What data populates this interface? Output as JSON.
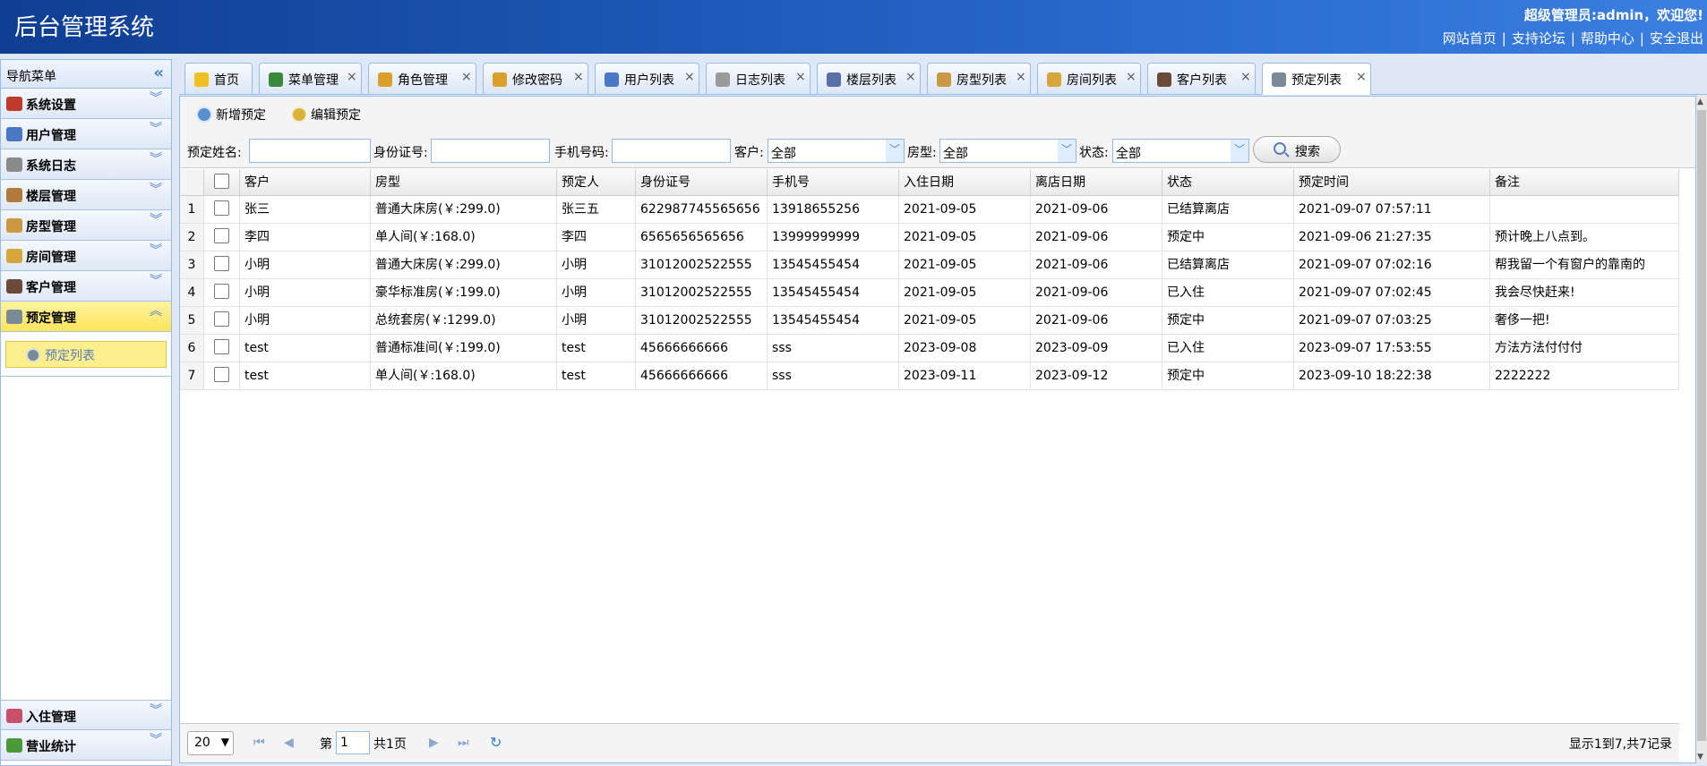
{
  "header": {
    "title": "后台管理系统",
    "welcome": "超级管理员:admin，欢迎您!",
    "links": [
      "网站首页",
      "支持论坛",
      "帮助中心",
      "安全退出"
    ]
  },
  "sidebar": {
    "title": "导航菜单",
    "items": [
      {
        "label": "系统设置",
        "icon": "tools-icon",
        "color": "#c0392b"
      },
      {
        "label": "用户管理",
        "icon": "users-icon",
        "color": "#4a78c8"
      },
      {
        "label": "系统日志",
        "icon": "log-icon",
        "color": "#8a8a8a"
      },
      {
        "label": "楼层管理",
        "icon": "house-icon",
        "color": "#b07a3a"
      },
      {
        "label": "房型管理",
        "icon": "house-icon",
        "color": "#c99a43"
      },
      {
        "label": "房间管理",
        "icon": "house-icon",
        "color": "#d6a63a"
      },
      {
        "label": "客户管理",
        "icon": "person-icon",
        "color": "#6b4a3a"
      },
      {
        "label": "预定管理",
        "icon": "clock-icon",
        "color": "#7a8b96"
      }
    ],
    "sub_item": "预定列表",
    "bottom_items": [
      {
        "label": "入住管理",
        "icon": "checkin-icon",
        "color": "#c9506b"
      },
      {
        "label": "营业统计",
        "icon": "yen-icon",
        "color": "#4a9a3a"
      }
    ]
  },
  "tabs": [
    {
      "label": "首页",
      "icon": "bulb-icon",
      "color": "#f0c020",
      "closable": false
    },
    {
      "label": "菜单管理",
      "icon": "sitemap-icon",
      "color": "#3b8a3b",
      "closable": true
    },
    {
      "label": "角色管理",
      "icon": "users-icon",
      "color": "#d9a02a",
      "closable": true
    },
    {
      "label": "修改密码",
      "icon": "lock-icon",
      "color": "#d9a02a",
      "closable": true
    },
    {
      "label": "用户列表",
      "icon": "users-icon",
      "color": "#4a78c8",
      "closable": true
    },
    {
      "label": "日志列表",
      "icon": "doc-icon",
      "color": "#9a9a9a",
      "closable": true
    },
    {
      "label": "楼层列表",
      "icon": "house-icon",
      "color": "#5a6fa8",
      "closable": true
    },
    {
      "label": "房型列表",
      "icon": "house-icon",
      "color": "#c99a43",
      "closable": true
    },
    {
      "label": "房间列表",
      "icon": "house-icon",
      "color": "#d6a63a",
      "closable": true
    },
    {
      "label": "客户列表",
      "icon": "person-icon",
      "color": "#6b4a3a",
      "closable": true
    },
    {
      "label": "预定列表",
      "icon": "clock-icon",
      "color": "#7a8b96",
      "closable": true,
      "active": true
    }
  ],
  "toolbar": {
    "add_label": "新增预定",
    "edit_label": "编辑预定"
  },
  "search": {
    "name_label": "预定姓名:",
    "id_label": "身份证号:",
    "phone_label": "手机号码:",
    "customer_label": "客户:",
    "customer_value": "全部",
    "roomtype_label": "房型:",
    "roomtype_value": "全部",
    "status_label": "状态:",
    "status_value": "全部",
    "button_label": "搜索"
  },
  "grid": {
    "columns": [
      "客户",
      "房型",
      "预定人",
      "身份证号",
      "手机号",
      "入住日期",
      "离店日期",
      "状态",
      "预定时间",
      "备注"
    ],
    "rows": [
      [
        "1",
        "张三",
        "普通大床房(￥:299.0)",
        "张三五",
        "622987745565656",
        "13918655256",
        "2021-09-05",
        "2021-09-06",
        "已结算离店",
        "2021-09-07 07:57:11",
        ""
      ],
      [
        "2",
        "李四",
        "单人间(￥:168.0)",
        "李四",
        "6565656565656",
        "13999999999",
        "2021-09-05",
        "2021-09-06",
        "预定中",
        "2021-09-06 21:27:35",
        "预计晚上八点到。"
      ],
      [
        "3",
        "小明",
        "普通大床房(￥:299.0)",
        "小明",
        "31012002522555",
        "13545455454",
        "2021-09-05",
        "2021-09-06",
        "已结算离店",
        "2021-09-07 07:02:16",
        "帮我留一个有窗户的靠南的"
      ],
      [
        "4",
        "小明",
        "豪华标准房(￥:199.0)",
        "小明",
        "31012002522555",
        "13545455454",
        "2021-09-05",
        "2021-09-06",
        "已入住",
        "2021-09-07 07:02:45",
        "我会尽快赶来!"
      ],
      [
        "5",
        "小明",
        "总统套房(￥:1299.0)",
        "小明",
        "31012002522555",
        "13545455454",
        "2021-09-05",
        "2021-09-06",
        "预定中",
        "2021-09-07 07:03:25",
        "奢侈一把!"
      ],
      [
        "6",
        "test",
        "普通标准间(￥:199.0)",
        "test",
        "45666666666",
        "sss",
        "2023-09-08",
        "2023-09-09",
        "已入住",
        "2023-09-07 17:53:55",
        "方法方法付付付"
      ],
      [
        "7",
        "test",
        "单人间(￥:168.0)",
        "test",
        "45666666666",
        "sss",
        "2023-09-11",
        "2023-09-12",
        "预定中",
        "2023-09-10 18:22:38",
        "2222222"
      ]
    ]
  },
  "pager": {
    "page_size": "20",
    "page_prefix": "第",
    "page_value": "1",
    "page_total": "共1页",
    "info": "显示1到7,共7记录"
  }
}
